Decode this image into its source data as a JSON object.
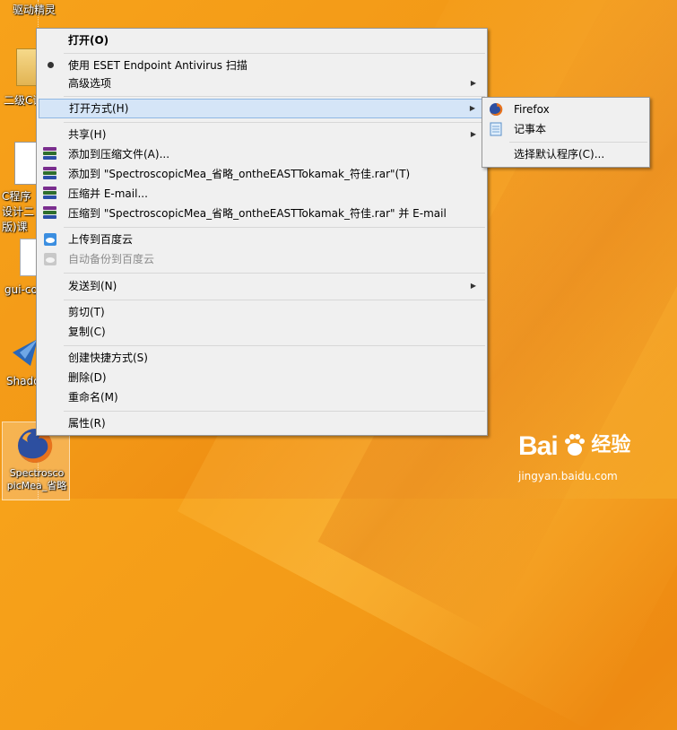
{
  "desktop": {
    "icons": [
      {
        "label": "驱动精灵"
      },
      {
        "label": "二级C语言版"
      },
      {
        "label": "C程序设计二版)课"
      },
      {
        "label": "gui-co"
      },
      {
        "label": "Shado"
      },
      {
        "label": "Spectrosco picMea_省略"
      }
    ]
  },
  "context_menu": {
    "items": [
      {
        "label": "打开(O)"
      },
      {
        "label": "使用 ESET Endpoint Antivirus 扫描"
      },
      {
        "label": "高级选项"
      },
      {
        "label": "打开方式(H)"
      },
      {
        "label": "共享(H)"
      },
      {
        "label": "添加到压缩文件(A)..."
      },
      {
        "label": "添加到 \"SpectroscopicMea_省略_ontheEASTTokamak_符佳.rar\"(T)"
      },
      {
        "label": "压缩并 E-mail..."
      },
      {
        "label": "压缩到 \"SpectroscopicMea_省略_ontheEASTTokamak_符佳.rar\" 并 E-mail"
      },
      {
        "label": "上传到百度云"
      },
      {
        "label": "自动备份到百度云"
      },
      {
        "label": "发送到(N)"
      },
      {
        "label": "剪切(T)"
      },
      {
        "label": "复制(C)"
      },
      {
        "label": "创建快捷方式(S)"
      },
      {
        "label": "删除(D)"
      },
      {
        "label": "重命名(M)"
      },
      {
        "label": "属性(R)"
      }
    ]
  },
  "open_with_submenu": {
    "items": [
      {
        "label": "Firefox",
        "icon": "firefox-icon"
      },
      {
        "label": "记事本",
        "icon": "notepad-icon"
      },
      {
        "label": "选择默认程序(C)..."
      }
    ]
  },
  "watermark": {
    "logo": "Bai",
    "logo_suffix": "经验",
    "url": "jingyan.baidu.com"
  },
  "colors": {
    "highlight_bg": "#d5e5f7",
    "highlight_border": "#8fb7e3",
    "menu_bg": "#f0f0f0",
    "desktop_orange": "#f39a17"
  }
}
